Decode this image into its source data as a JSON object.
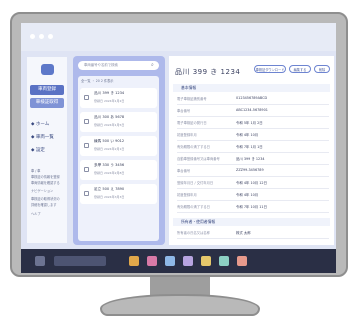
{
  "sidebar": {
    "primary_button": "車両登録",
    "secondary_button": "車検証取得",
    "nav": [
      "ホーム",
      "車両一覧",
      "設定"
    ],
    "notes": [
      "車 / 車",
      "車検証の情報を登録",
      "車両情報を確認する",
      "ナビゲーション",
      "車検証の取得状況の",
      "詳細を確認します",
      "ヘルプ"
    ]
  },
  "search": {
    "placeholder": "車両番号や名前で検索"
  },
  "list": {
    "header": "全一覧 ・ 20  2  件表示",
    "items": [
      {
        "title": "品川  399 き 1234",
        "sub": "登録日 2024年1月2日"
      },
      {
        "title": "品川  300 あ 5678",
        "sub": "登録日 2024年1月5日"
      },
      {
        "title": "練馬  500 い 9012",
        "sub": "登録日 2024年2月1日"
      },
      {
        "title": "多摩  330 う 3456",
        "sub": "登録日 2024年2月8日"
      },
      {
        "title": "足立  500 え 7890",
        "sub": "登録日 2024年3月3日"
      }
    ]
  },
  "detail": {
    "title": "品川  399  き  1234",
    "buttons": [
      "車検証ダウンロード",
      "編集する",
      "削除"
    ],
    "section1": "基本情報",
    "rows": [
      {
        "k": "電子車検証識別番号",
        "v": "0123456789ABCD"
      },
      {
        "k": "車台番号",
        "v": "ABC1234-5678901"
      },
      {
        "k": "電子車検証の発行日",
        "v": "令和 5年 1月 2日"
      },
      {
        "k": "初度登録年月",
        "v": "令和 4年 10月"
      },
      {
        "k": "有効期限の満了する日",
        "v": "令和 7年 1月 1日"
      },
      {
        "k": "自動車登録番号又は車両番号",
        "v": "品川  399  き  1234"
      },
      {
        "k": "車台番号",
        "v": "ZZZ99-3456789"
      },
      {
        "k": "登録年月日 / 交付年月日",
        "v": "令和 4年 10月 12日"
      },
      {
        "k": "初度登録年月",
        "v": "令和 4年 10月"
      },
      {
        "k": "有効期限の満了する日",
        "v": "令和 7年 10月 11日"
      }
    ],
    "section2": "所有者・使用者情報",
    "rows2": [
      {
        "k": "所有者の氏名又は名称",
        "v": "株式  太郎"
      }
    ]
  },
  "colors": {
    "accent": "#5a72c4",
    "list_bg": "#aeb9eb",
    "taskbar": "#2a2f45"
  }
}
